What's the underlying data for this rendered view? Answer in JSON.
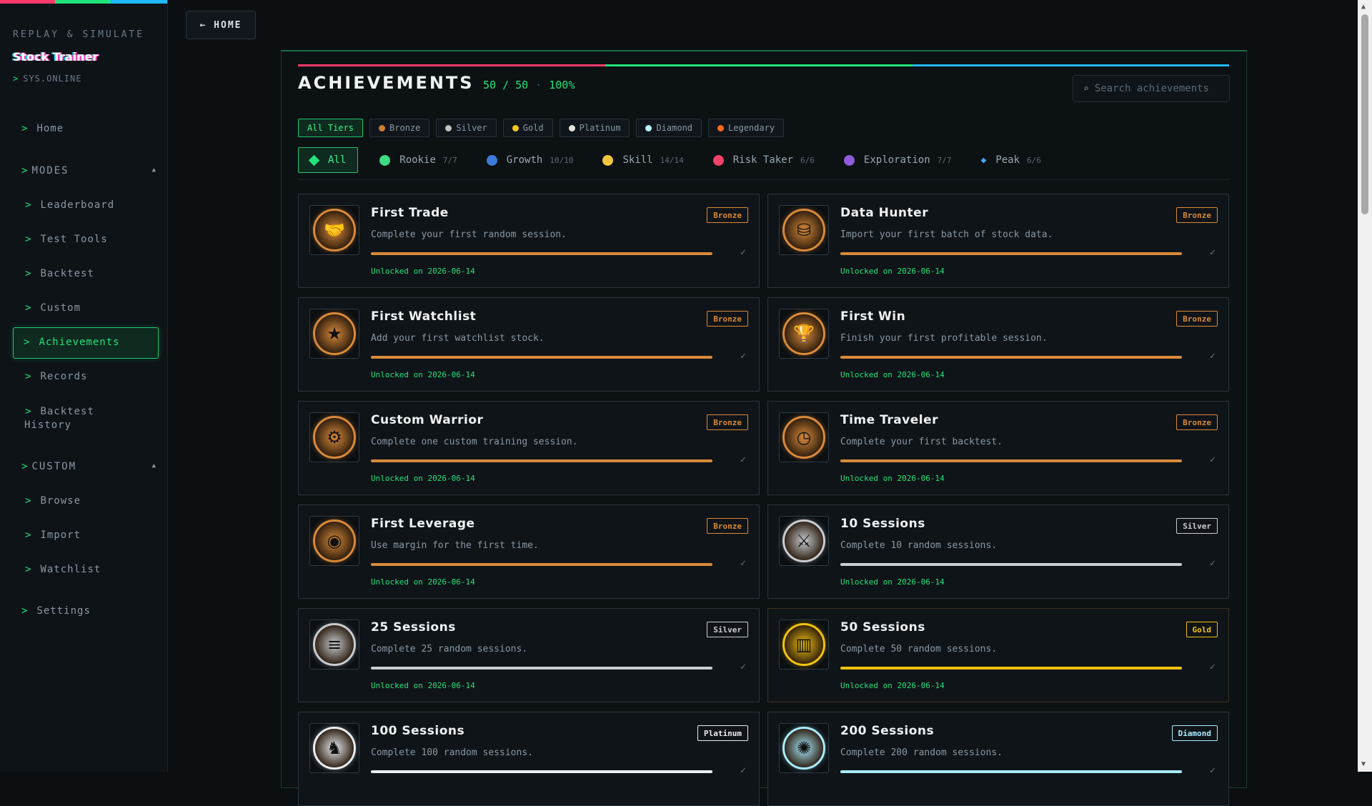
{
  "sidebar": {
    "tagline": "REPLAY & SIMULATE",
    "app_title": "Stock Trainer",
    "status": "SYS.ONLINE",
    "items": [
      {
        "label": "Home"
      },
      {
        "label": "MODES"
      },
      {
        "label": "Leaderboard"
      },
      {
        "label": "Test Tools"
      },
      {
        "label": "Backtest"
      },
      {
        "label": "Custom"
      },
      {
        "label": "Achievements"
      },
      {
        "label": "Records"
      },
      {
        "label": "Backtest"
      },
      {
        "label": "History"
      },
      {
        "label": "CUSTOM"
      },
      {
        "label": "Browse"
      },
      {
        "label": "Import"
      },
      {
        "label": "Watchlist"
      },
      {
        "label": "Settings"
      }
    ],
    "prompt": ">"
  },
  "home_button": "← HOME",
  "header": {
    "title": "ACHIEVEMENTS",
    "unlocked": "50 / 50",
    "sep": "·",
    "percent": "100%",
    "search_placeholder": "Search achievements"
  },
  "tiers": [
    {
      "label": "All Tiers",
      "color": ""
    },
    {
      "label": "Bronze",
      "color": "#cd7f32"
    },
    {
      "label": "Silver",
      "color": "#c0c0c0"
    },
    {
      "label": "Gold",
      "color": "#f5c518"
    },
    {
      "label": "Platinum",
      "color": "#e5e4e2"
    },
    {
      "label": "Diamond",
      "color": "#b9f2ff"
    },
    {
      "label": "Legendary",
      "color": "#ff6a1a"
    }
  ],
  "categories": [
    {
      "label": "All",
      "count": "",
      "color": "#22e37a"
    },
    {
      "label": "Rookie",
      "count": "7/7",
      "color": "#3ddc84"
    },
    {
      "label": "Growth",
      "count": "10/10",
      "color": "#3b7bdc"
    },
    {
      "label": "Skill",
      "count": "14/14",
      "color": "#f5c542"
    },
    {
      "label": "Risk Taker",
      "count": "6/6",
      "color": "#f0426a"
    },
    {
      "label": "Exploration",
      "count": "7/7",
      "color": "#8e5cd9"
    },
    {
      "label": "Peak",
      "count": "6/6",
      "color": "#4aa3ff"
    }
  ],
  "achievements": [
    {
      "title": "First Trade",
      "desc": "Complete your first random session.",
      "tier": "Bronze",
      "tier_color": "#d98a3a",
      "unlocked": "Unlocked on 2026-06-14",
      "progress": 1.0,
      "icon": "handshake-icon",
      "check": "✓"
    },
    {
      "title": "Data Hunter",
      "desc": "Import your first batch of stock data.",
      "tier": "Bronze",
      "tier_color": "#d98a3a",
      "unlocked": "Unlocked on 2026-06-14",
      "progress": 1.0,
      "icon": "database-icon",
      "check": "✓"
    },
    {
      "title": "First Watchlist",
      "desc": "Add your first watchlist stock.",
      "tier": "Bronze",
      "tier_color": "#d98a3a",
      "unlocked": "Unlocked on 2026-06-14",
      "progress": 1.0,
      "icon": "star-icon",
      "check": "✓"
    },
    {
      "title": "First Win",
      "desc": "Finish your first profitable session.",
      "tier": "Bronze",
      "tier_color": "#d98a3a",
      "unlocked": "Unlocked on 2026-06-14",
      "progress": 1.0,
      "icon": "trophy-icon",
      "check": "✓"
    },
    {
      "title": "Custom Warrior",
      "desc": "Complete one custom training session.",
      "tier": "Bronze",
      "tier_color": "#d98a3a",
      "unlocked": "Unlocked on 2026-06-14",
      "progress": 1.0,
      "icon": "gear-icon",
      "check": "✓"
    },
    {
      "title": "Time Traveler",
      "desc": "Complete your first backtest.",
      "tier": "Bronze",
      "tier_color": "#d98a3a",
      "unlocked": "Unlocked on 2026-06-14",
      "progress": 1.0,
      "icon": "clock-icon",
      "check": "✓"
    },
    {
      "title": "First Leverage",
      "desc": "Use margin for the first time.",
      "tier": "Bronze",
      "tier_color": "#d98a3a",
      "unlocked": "Unlocked on 2026-06-14",
      "progress": 1.0,
      "icon": "coins-icon",
      "check": "✓"
    },
    {
      "title": "10 Sessions",
      "desc": "Complete 10 random sessions.",
      "tier": "Silver",
      "tier_color": "#c8cdd2",
      "unlocked": "Unlocked on 2026-06-14",
      "progress": 1.0,
      "icon": "sword-icon",
      "check": "✓"
    },
    {
      "title": "25 Sessions",
      "desc": "Complete 25 random sessions.",
      "tier": "Silver",
      "tier_color": "#c8cdd2",
      "unlocked": "Unlocked on 2026-06-14",
      "progress": 1.0,
      "icon": "tally-icon",
      "check": "✓"
    },
    {
      "title": "50 Sessions",
      "desc": "Complete 50 random sessions.",
      "tier": "Gold",
      "tier_color": "#f2c20f",
      "unlocked": "Unlocked on 2026-06-14",
      "progress": 1.0,
      "icon": "chart-icon",
      "check": "✓"
    },
    {
      "title": "100 Sessions",
      "desc": "Complete 100 random sessions.",
      "tier": "Platinum",
      "tier_color": "#e9eef2",
      "unlocked": "",
      "progress": 1.0,
      "icon": "runner-icon",
      "check": "✓"
    },
    {
      "title": "200 Sessions",
      "desc": "Complete 200 random sessions.",
      "tier": "Diamond",
      "tier_color": "#a8ecff",
      "unlocked": "",
      "progress": 1.0,
      "icon": "burst-icon",
      "check": "✓"
    }
  ]
}
